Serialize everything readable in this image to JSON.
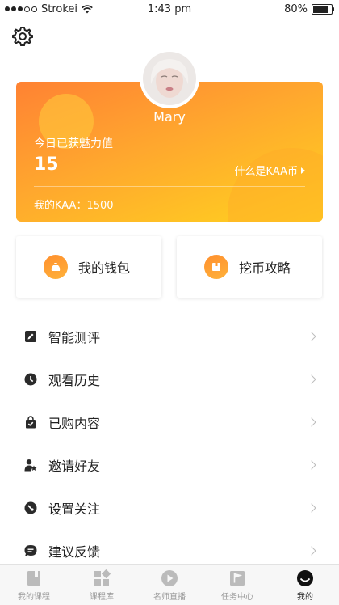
{
  "status_bar": {
    "carrier": "Strokei",
    "time": "1:43 pm",
    "battery": "80%",
    "battery_level": 0.8
  },
  "profile": {
    "name": "Mary"
  },
  "charm_card": {
    "label": "今日已获魅力值",
    "value": "15",
    "link": "什么是KAA币",
    "kaa_balance": "我的KAA：1500"
  },
  "tiles": [
    {
      "label": "我的钱包",
      "icon": "wallet-bag-icon"
    },
    {
      "label": "挖币攻略",
      "icon": "guide-box-icon"
    }
  ],
  "menu": [
    {
      "label": "智能测评",
      "icon": "edit-icon"
    },
    {
      "label": "观看历史",
      "icon": "clock-icon"
    },
    {
      "label": "已购内容",
      "icon": "shopping-bag-icon"
    },
    {
      "label": "邀请好友",
      "icon": "person-star-icon"
    },
    {
      "label": "设置关注",
      "icon": "settings-dial-icon"
    },
    {
      "label": "建议反馈",
      "icon": "chat-bubble-icon"
    }
  ],
  "tabs": [
    {
      "label": "我的课程",
      "icon": "book-icon",
      "active": false
    },
    {
      "label": "课程库",
      "icon": "grid-icon",
      "active": false
    },
    {
      "label": "名师直播",
      "icon": "play-icon",
      "active": false
    },
    {
      "label": "任务中心",
      "icon": "flag-icon",
      "active": false
    },
    {
      "label": "我的",
      "icon": "profile-face-icon",
      "active": true
    }
  ],
  "colors": {
    "accent_orange": "#ff8233",
    "accent_yellow": "#ffd21f",
    "inactive_tab": "#999999",
    "active_tab": "#222222"
  }
}
